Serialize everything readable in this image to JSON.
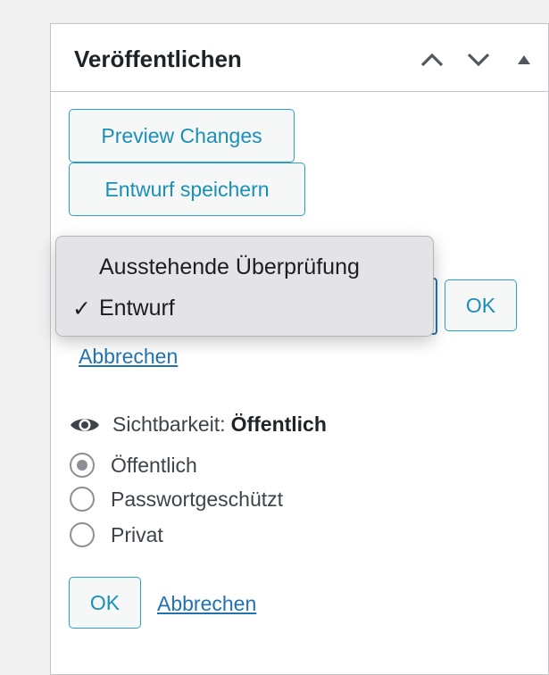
{
  "panel": {
    "title": "Veröffentlichen",
    "icons": [
      "chevron-up-icon",
      "chevron-down-icon",
      "triangle-up-icon"
    ]
  },
  "buttons": {
    "preview": "Preview Changes",
    "save_draft": "Entwurf speichern",
    "status_ok": "OK",
    "visibility_ok": "OK"
  },
  "status_dropdown": {
    "options": [
      {
        "label": "Ausstehende Überprüfung",
        "selected": false
      },
      {
        "label": "Entwurf",
        "selected": true
      }
    ],
    "check_mark": "✓"
  },
  "status_cancel": "Abbrechen",
  "visibility": {
    "label": "Sichtbarkeit:",
    "value": "Öffentlich",
    "options": [
      {
        "label": "Öffentlich",
        "checked": true
      },
      {
        "label": "Passwortgeschützt",
        "checked": false
      },
      {
        "label": "Privat",
        "checked": false
      }
    ],
    "cancel": "Abbrechen"
  },
  "colors": {
    "accent": "#2271b1",
    "button_text": "#1a8fb8",
    "panel_bg": "#ffffff",
    "page_bg": "#f0f0f1"
  }
}
